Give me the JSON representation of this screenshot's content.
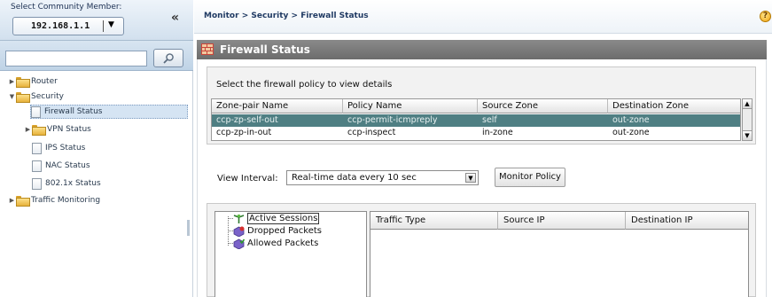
{
  "sidebar": {
    "member_label": "Select Community Member:",
    "member_value": "192.168.1.1",
    "collapse_label": "«",
    "search_placeholder": "",
    "tree": [
      {
        "label": "Router"
      },
      {
        "label": "Security"
      },
      {
        "label": "Firewall Status",
        "selected": true
      },
      {
        "label": "VPN Status"
      },
      {
        "label": "IPS Status"
      },
      {
        "label": "NAC Status"
      },
      {
        "label": "802.1x Status"
      },
      {
        "label": "Traffic Monitoring"
      }
    ]
  },
  "header": {
    "breadcrumb": "Monitor > Security > Firewall Status",
    "help_label": "?"
  },
  "page": {
    "title": "Firewall Status",
    "policy_caption": "Select the firewall policy to view details",
    "policy_table": {
      "columns": [
        "Zone-pair Name",
        "Policy Name",
        "Source Zone",
        "Destination Zone"
      ],
      "rows": [
        [
          "ccp-zp-self-out",
          "ccp-permit-icmpreply",
          "self",
          "out-zone"
        ],
        [
          "ccp-zp-in-out",
          "ccp-inspect",
          "in-zone",
          "out-zone"
        ]
      ],
      "selected_row": 0
    },
    "interval_label": "View Interval:",
    "interval_value": "Real-time data every 10 sec",
    "monitor_button": "Monitor Policy",
    "tree_items": [
      "Active Sessions",
      "Dropped Packets",
      "Allowed Packets"
    ],
    "traffic_table": {
      "columns": [
        "Traffic Type",
        "Source IP",
        "Destination IP"
      ]
    }
  },
  "colors": {
    "selected_row": "#4f7f83",
    "title_bar": "#7a7a7a",
    "nav_highlight": "#d5e4f3"
  }
}
